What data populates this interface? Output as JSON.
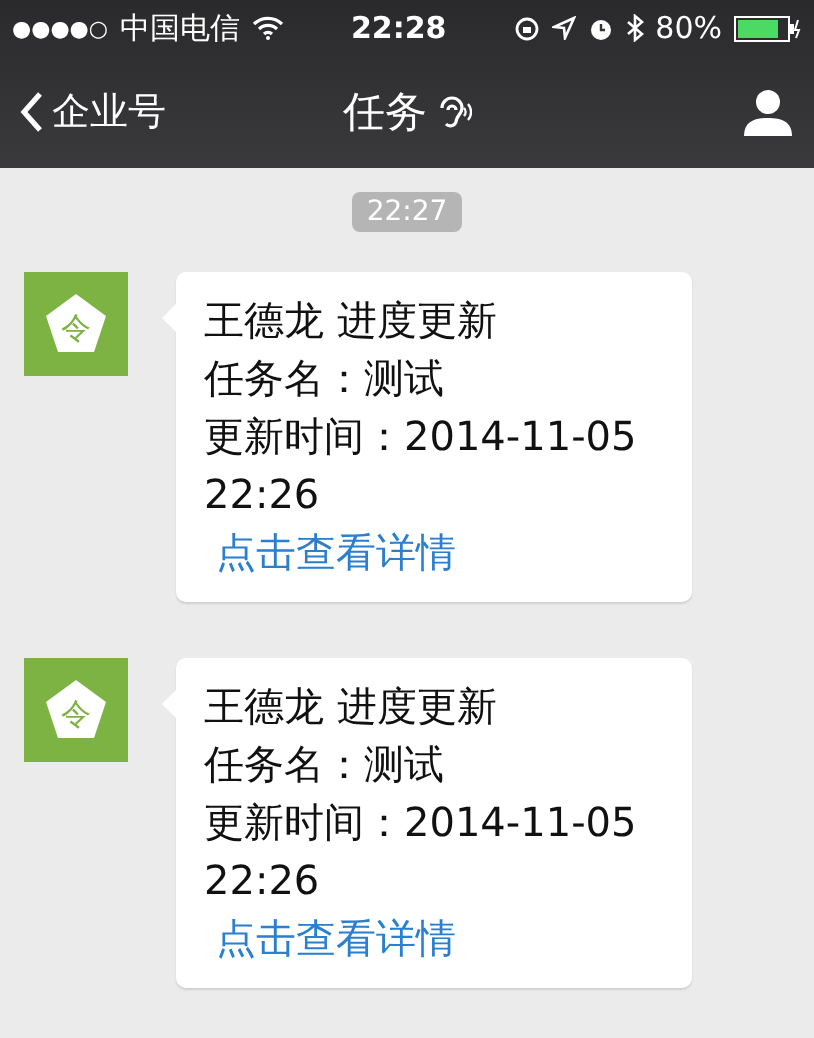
{
  "status_bar": {
    "signal": "●●●●○",
    "carrier": "中国电信",
    "time": "22:28",
    "battery": "80%"
  },
  "nav_bar": {
    "back": "企业号",
    "title": "任务"
  },
  "timestamp": "22:27",
  "messages": [
    {
      "avatar_glyph": "令",
      "title": "王德龙 进度更新",
      "task": "任务名：测试",
      "update_time": "更新时间：2014-11-05 22:26",
      "link": "点击查看详情"
    },
    {
      "avatar_glyph": "令",
      "title": "王德龙 进度更新",
      "task": "任务名：测试",
      "update_time": "更新时间：2014-11-05 22:26",
      "link": "点击查看详情"
    }
  ]
}
